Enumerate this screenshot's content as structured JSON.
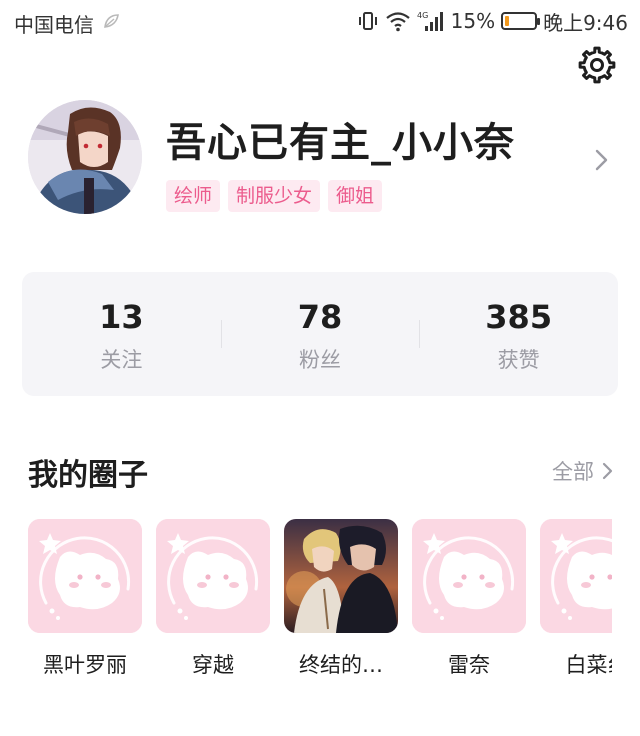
{
  "status_bar": {
    "carrier": "中国电信",
    "network": "4G",
    "battery": "15%",
    "battery_level": 0.15,
    "time": "晚上9:46"
  },
  "profile": {
    "username": "吾心已有主_小小奈",
    "tags": [
      "绘师",
      "制服少女",
      "御姐"
    ]
  },
  "stats": [
    {
      "value": "13",
      "label": "关注"
    },
    {
      "value": "78",
      "label": "粉丝"
    },
    {
      "value": "385",
      "label": "获赞"
    }
  ],
  "circles": {
    "title": "我的圈子",
    "see_all": "全部",
    "items": [
      {
        "name": "黑叶罗丽",
        "image": "default-pink-placeholder"
      },
      {
        "name": "穿越",
        "image": "default-pink-placeholder"
      },
      {
        "name": "终结的…",
        "image": "anime-artwork"
      },
      {
        "name": "雷奈",
        "image": "default-pink-placeholder"
      },
      {
        "name": "白菜纟",
        "image": "default-pink-placeholder"
      }
    ]
  },
  "colors": {
    "tag_bg": "#fdeaf1",
    "tag_text": "#ec5c8d",
    "placeholder_bg": "#fbd8e3",
    "stats_bg": "#f5f5f8",
    "muted_text": "#9c9ca4"
  }
}
